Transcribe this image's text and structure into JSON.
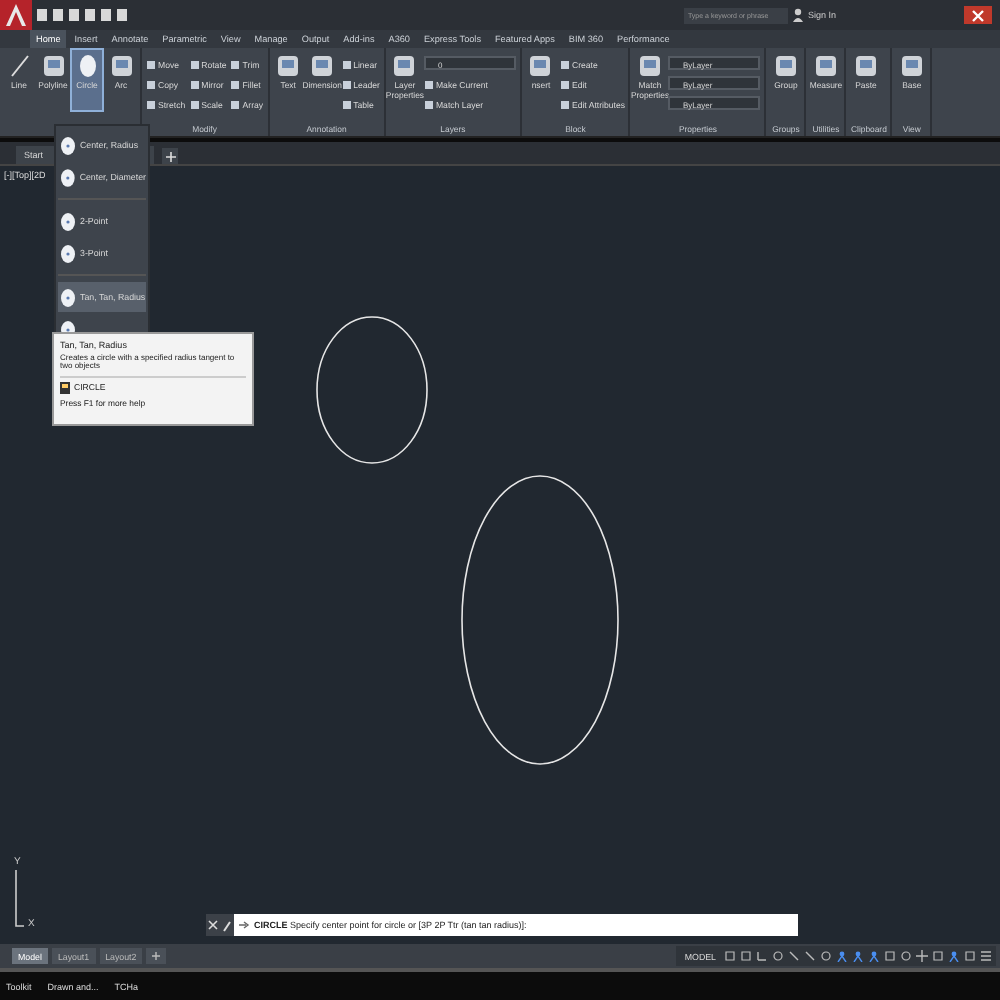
{
  "title_bar": {
    "search_placeholder": "Type a keyword or phrase",
    "sign_in": "Sign In"
  },
  "ribbon_tabs": [
    {
      "label": "Home",
      "selected": true
    },
    {
      "label": "Insert",
      "selected": false
    },
    {
      "label": "Annotate",
      "selected": false
    },
    {
      "label": "Parametric",
      "selected": false
    },
    {
      "label": "View",
      "selected": false
    },
    {
      "label": "Manage",
      "selected": false
    },
    {
      "label": "Output",
      "selected": false
    },
    {
      "label": "Add-ins",
      "selected": false
    },
    {
      "label": "A360",
      "selected": false
    },
    {
      "label": "Express Tools",
      "selected": false
    },
    {
      "label": "Featured Apps",
      "selected": false
    },
    {
      "label": "BIM 360",
      "selected": false
    },
    {
      "label": "Performance",
      "selected": false
    }
  ],
  "ribbon_panels": [
    {
      "tools": [
        {
          "label": "Line",
          "kind": "large",
          "open": false
        },
        {
          "label": "Polyline",
          "kind": "large",
          "open": false
        },
        {
          "label": "Circle",
          "kind": "large",
          "open": true
        },
        {
          "label": "Arc",
          "kind": "large",
          "open": false
        }
      ]
    },
    {
      "title": "Modify",
      "tools": [
        {
          "label": "Move",
          "kind": "small"
        },
        {
          "label": "Copy",
          "kind": "small"
        },
        {
          "label": "Stretch",
          "kind": "small"
        },
        {
          "label": "Rotate",
          "kind": "small"
        },
        {
          "label": "Mirror",
          "kind": "small"
        },
        {
          "label": "Scale",
          "kind": "small"
        },
        {
          "label": "Trim",
          "kind": "small"
        },
        {
          "label": "Fillet",
          "kind": "small"
        },
        {
          "label": "Array",
          "kind": "small"
        }
      ]
    },
    {
      "title": "Annotation",
      "tools": [
        {
          "label": "Text",
          "kind": "large"
        },
        {
          "label": "Dimension",
          "kind": "large"
        },
        {
          "label": "Linear",
          "kind": "small"
        },
        {
          "label": "Leader",
          "kind": "small"
        },
        {
          "label": "Table",
          "kind": "small"
        }
      ]
    },
    {
      "title": "Layers",
      "tools": [
        {
          "label": "Layer Properties",
          "kind": "large"
        },
        {
          "label": "0",
          "kind": "dropdown"
        },
        {
          "label": "Make Current",
          "kind": "small"
        },
        {
          "label": "Match Layer",
          "kind": "small"
        }
      ]
    },
    {
      "title": "Block",
      "tools": [
        {
          "label": "nsert",
          "kind": "large"
        },
        {
          "label": "Create",
          "kind": "small"
        },
        {
          "label": "Edit",
          "kind": "small"
        },
        {
          "label": "Edit Attributes",
          "kind": "small"
        }
      ]
    },
    {
      "title": "Properties",
      "tools": [
        {
          "label": "Match Properties",
          "kind": "large"
        },
        {
          "label": "ByLayer",
          "kind": "dropdown"
        },
        {
          "label": "ByLayer",
          "kind": "dropdown"
        },
        {
          "label": "ByLayer",
          "kind": "dropdown"
        }
      ]
    },
    {
      "title": "Groups",
      "tools": [
        {
          "label": "Group",
          "kind": "large"
        }
      ]
    },
    {
      "title": "Utilities",
      "tools": [
        {
          "label": "Measure",
          "kind": "large"
        }
      ]
    },
    {
      "title": "Clipboard",
      "tools": [
        {
          "label": "Paste",
          "kind": "large"
        }
      ]
    },
    {
      "title": "View",
      "tools": [
        {
          "label": "Base",
          "kind": "large"
        }
      ]
    }
  ],
  "file_tabs": [
    {
      "label": "Start",
      "selected": false
    }
  ],
  "viewport_label": "[-][Top][2D",
  "ucs": {
    "y_label": "Y",
    "x_label": "X"
  },
  "circle_menu": [
    {
      "label": "Center, Radius",
      "selected": false
    },
    {
      "label": "Center, Diameter",
      "selected": false
    },
    {
      "label": "2-Point",
      "selected": false
    },
    {
      "label": "3-Point",
      "selected": false
    },
    {
      "label": "Tan, Tan, Radius",
      "selected": true
    },
    {
      "selected": false
    }
  ],
  "tooltip": {
    "title": "Tan, Tan, Radius",
    "description": "Creates a circle with a specified radius tangent to two objects",
    "command": "CIRCLE",
    "help": "Press F1 for more help"
  },
  "command_line": {
    "text": "**CIRCLE** Specify center point for circle or [3P 2P Ttr (tan tan radius)]:"
  },
  "layout_tabs": [
    {
      "label": "Model",
      "selected": true
    },
    {
      "label": "Layout1",
      "selected": false
    },
    {
      "label": "Layout2",
      "selected": false
    }
  ],
  "status_bar": {
    "mode": "MODEL"
  },
  "taskbar": [
    "Toolkit",
    "Drawn and...",
    "TCHa"
  ]
}
